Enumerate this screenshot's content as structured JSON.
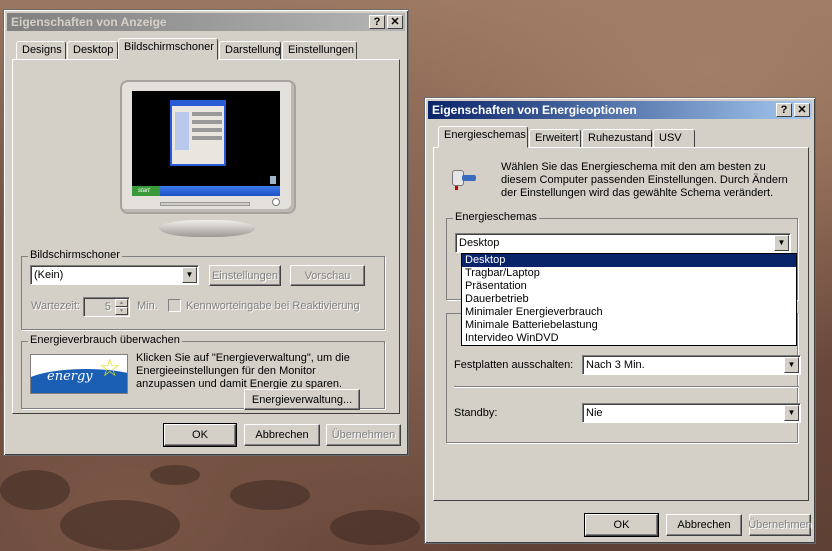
{
  "display_window": {
    "title": "Eigenschaften von Anzeige",
    "help": "?",
    "close": "✕",
    "tabs": [
      "Designs",
      "Desktop",
      "Bildschirmschoner",
      "Darstellung",
      "Einstellungen"
    ],
    "preview_taskbar": {
      "start": "start"
    },
    "screensaver_group": {
      "label": "Bildschirmschoner",
      "selected": "(Kein)",
      "settings_button": "Einstellungen",
      "preview_button": "Vorschau",
      "wait_label": "Wartezeit:",
      "wait_value": "5",
      "wait_unit": "Min.",
      "password_label": "Kennworteingabe bei Reaktivierung"
    },
    "energy_group": {
      "label": "Energieverbrauch überwachen",
      "description": "Klicken Sie auf \"Energieverwaltung\", um die Energieeinstellungen für den Monitor anzupassen und damit Energie zu sparen.",
      "button": "Energieverwaltung...",
      "logo_text": "energy"
    },
    "ok": "OK",
    "cancel": "Abbrechen",
    "apply": "Übernehmen"
  },
  "power_window": {
    "title": "Eigenschaften von Energieoptionen",
    "help": "?",
    "close": "✕",
    "tabs": [
      "Energieschemas",
      "Erweitert",
      "Ruhezustand",
      "USV"
    ],
    "description": "Wählen Sie das Energieschema mit den am besten zu diesem Computer passenden Einstellungen. Durch Ändern der Einstellungen wird das gewählte Schema verändert.",
    "schemes_group": {
      "label": "Energieschemas",
      "selected": "Desktop",
      "options": [
        "Desktop",
        "Tragbar/Laptop",
        "Präsentation",
        "Dauerbetrieb",
        "Minimaler Energieverbrauch",
        "Minimale Batteriebelastung",
        "Intervideo WinDVD"
      ]
    },
    "harddisk_label": "Festplatten ausschalten:",
    "harddisk_value": "Nach 3 Min.",
    "standby_label": "Standby:",
    "standby_value": "Nie",
    "ok": "OK",
    "cancel": "Abbrechen",
    "apply": "Übernehmen"
  }
}
